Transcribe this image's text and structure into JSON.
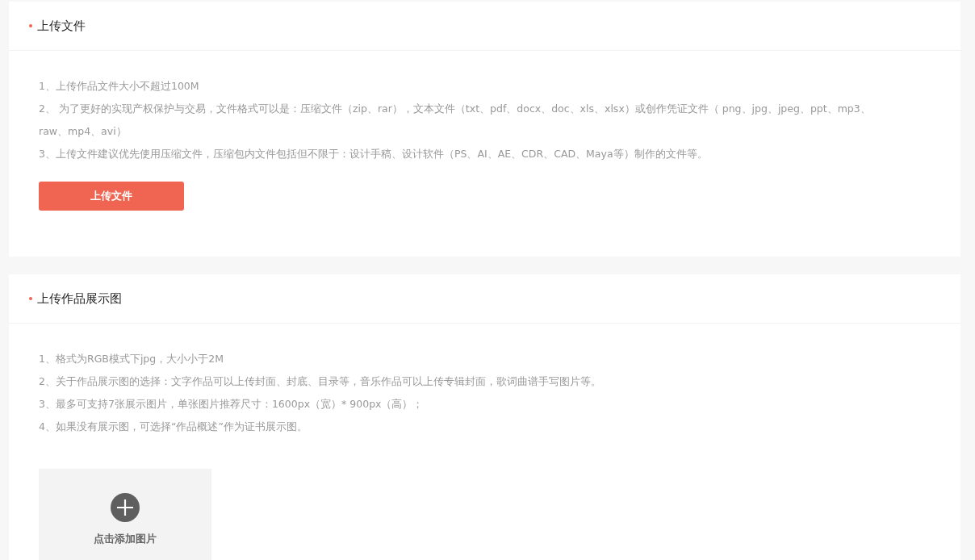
{
  "sections": [
    {
      "title": "上传文件",
      "notes": [
        "1、上传作品文件大小不超过100M",
        "2、 为了更好的实现产权保护与交易，文件格式可以是：压缩文件（zip、rar），文本文件（txt、pdf、docx、doc、xls、xlsx）或创作凭证文件（ png、jpg、jpeg、ppt、mp3、raw、mp4、avi）",
        "3、上传文件建议优先使用压缩文件，压缩包内文件包括但不限于：设计手稿、设计软件（PS、AI、AE、CDR、CAD、Maya等）制作的文件等。"
      ],
      "action": {
        "kind": "button",
        "label": "上传文件"
      }
    },
    {
      "title": "上传作品展示图",
      "notes": [
        "1、格式为RGB模式下jpg，大小小于2M",
        "2、关于作品展示图的选择：文字作品可以上传封面、封底、目录等，音乐作品可以上传专辑封面，歌词曲谱手写图片等。",
        "3、最多可支持7张展示图片，单张图片推荐尺寸：1600px（宽）* 900px（高）；",
        "4、如果没有展示图，可选择“作品概述”作为证书展示图。"
      ],
      "action": {
        "kind": "tile",
        "label": "点击添加图片"
      }
    }
  ]
}
